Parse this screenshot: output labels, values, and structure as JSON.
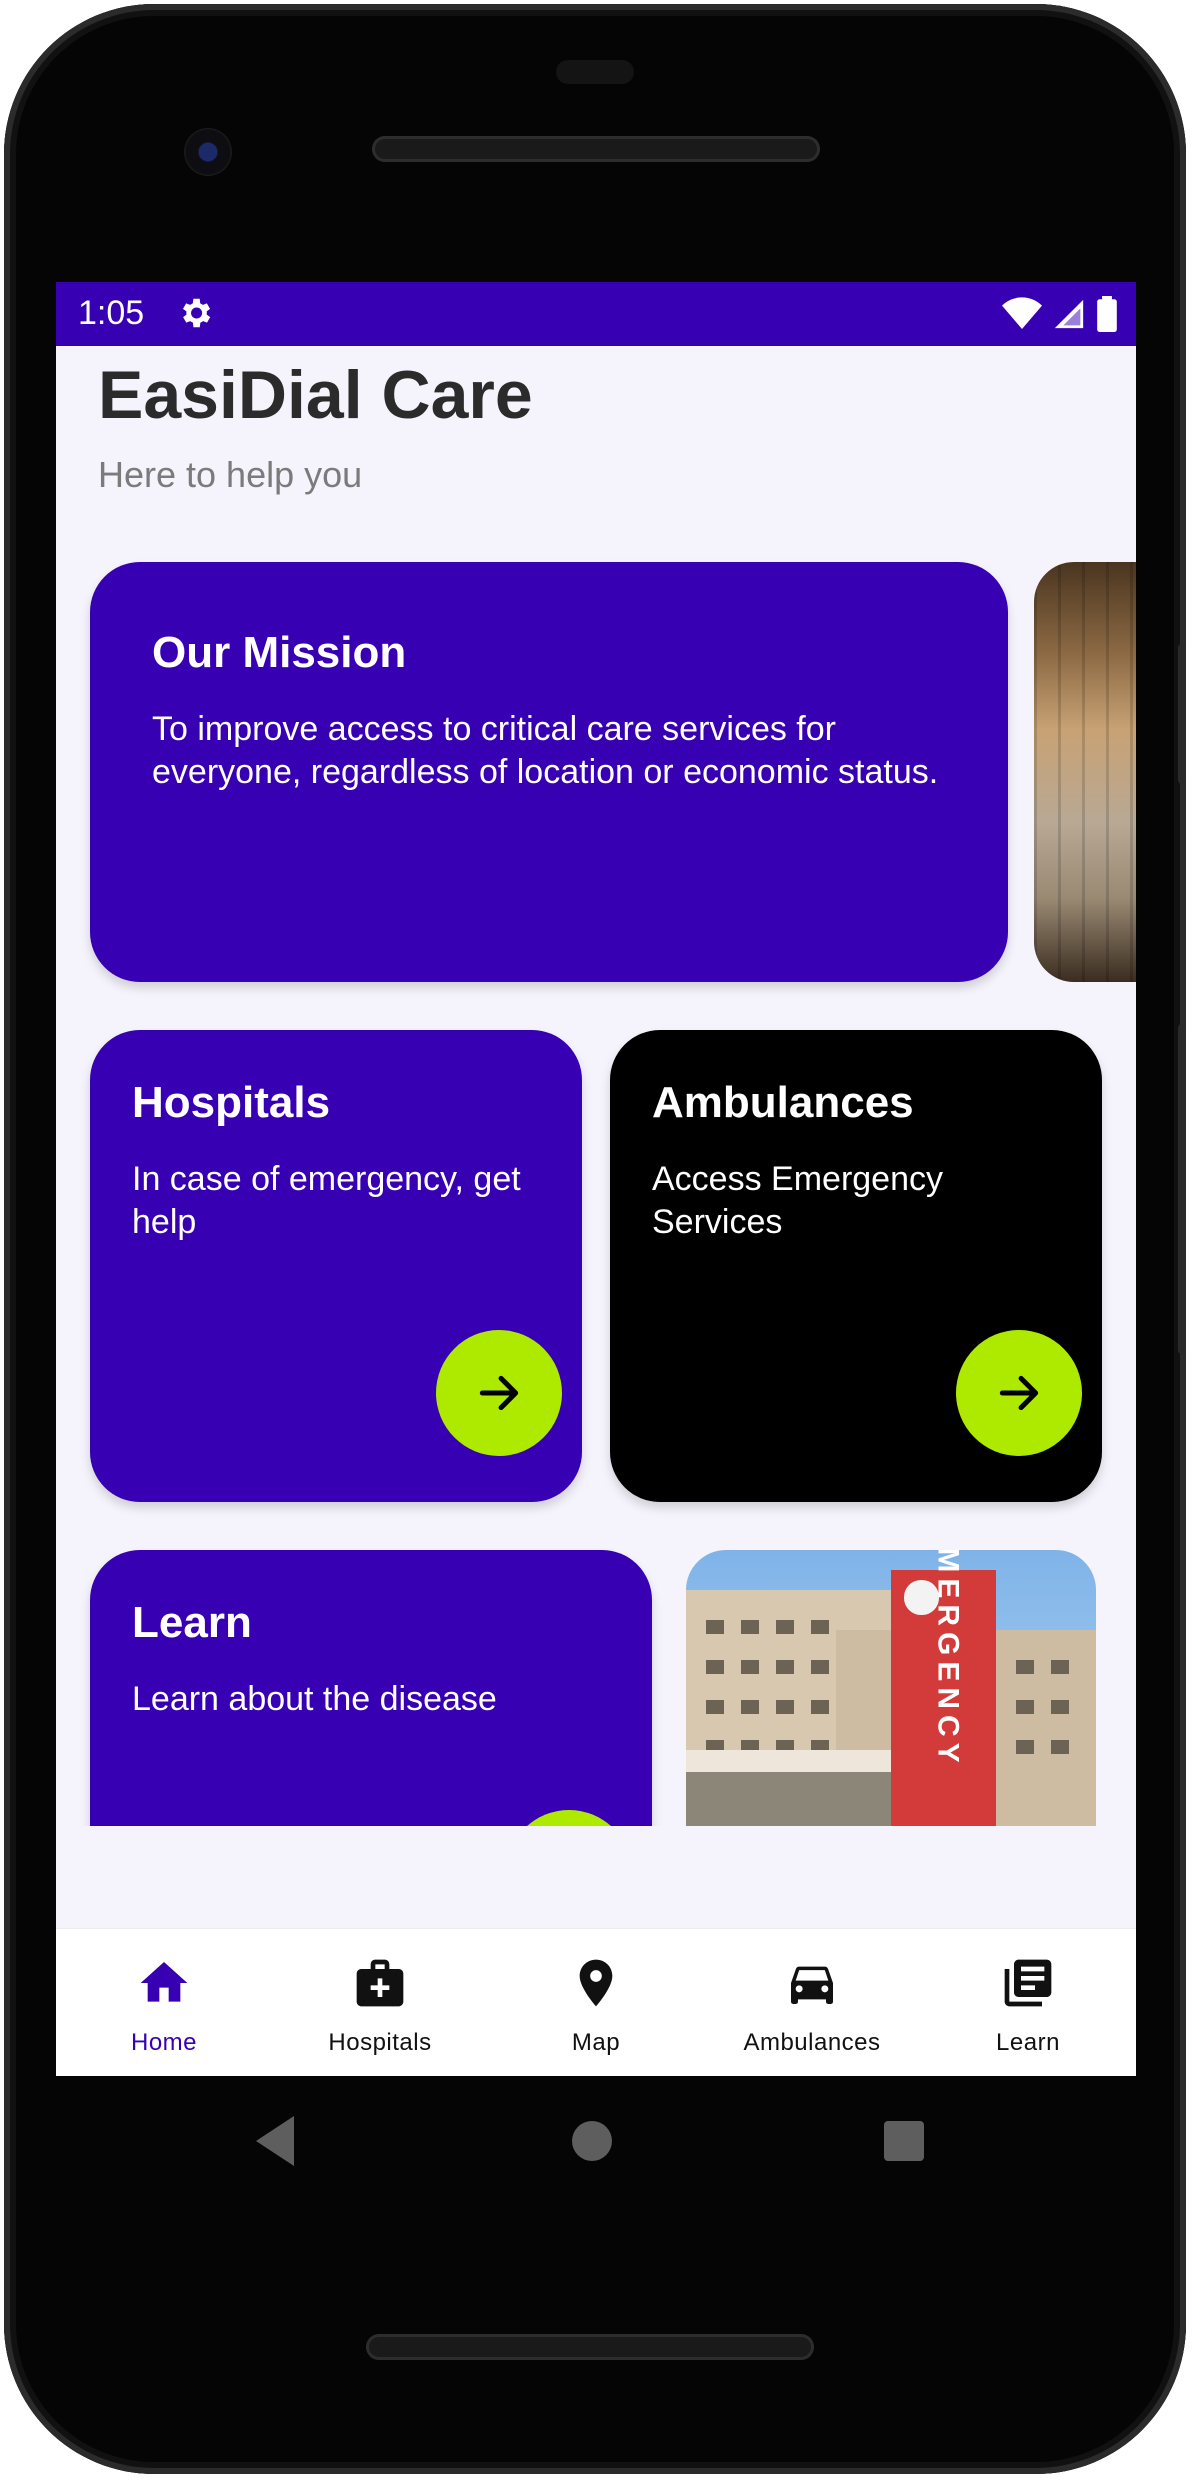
{
  "status_bar": {
    "time": "1:05"
  },
  "header": {
    "title": "EasiDial Care",
    "subtitle": "Here to help you"
  },
  "mission": {
    "title": "Our Mission",
    "text": "To improve access to critical care services for everyone, regardless of location or economic status."
  },
  "cards": {
    "hospitals": {
      "title": "Hospitals",
      "text": "In case of emergency, get help"
    },
    "ambulances": {
      "title": "Ambulances",
      "text": "Access Emergency Services"
    },
    "learn": {
      "title": "Learn",
      "text": "Learn about the disease"
    }
  },
  "hospital_image": {
    "sign_text": "EMERGENCY"
  },
  "bottom_nav": {
    "items": [
      {
        "label": "Home",
        "icon": "home-icon",
        "active": true
      },
      {
        "label": "Hospitals",
        "icon": "medical-bag-icon",
        "active": false
      },
      {
        "label": "Map",
        "icon": "map-pin-icon",
        "active": false
      },
      {
        "label": "Ambulances",
        "icon": "car-icon",
        "active": false
      },
      {
        "label": "Learn",
        "icon": "library-books-icon",
        "active": false
      }
    ]
  },
  "colors": {
    "primary": "#3700b3",
    "accent": "#aeea00",
    "card_dark": "#000000",
    "background": "#f5f3fb"
  }
}
